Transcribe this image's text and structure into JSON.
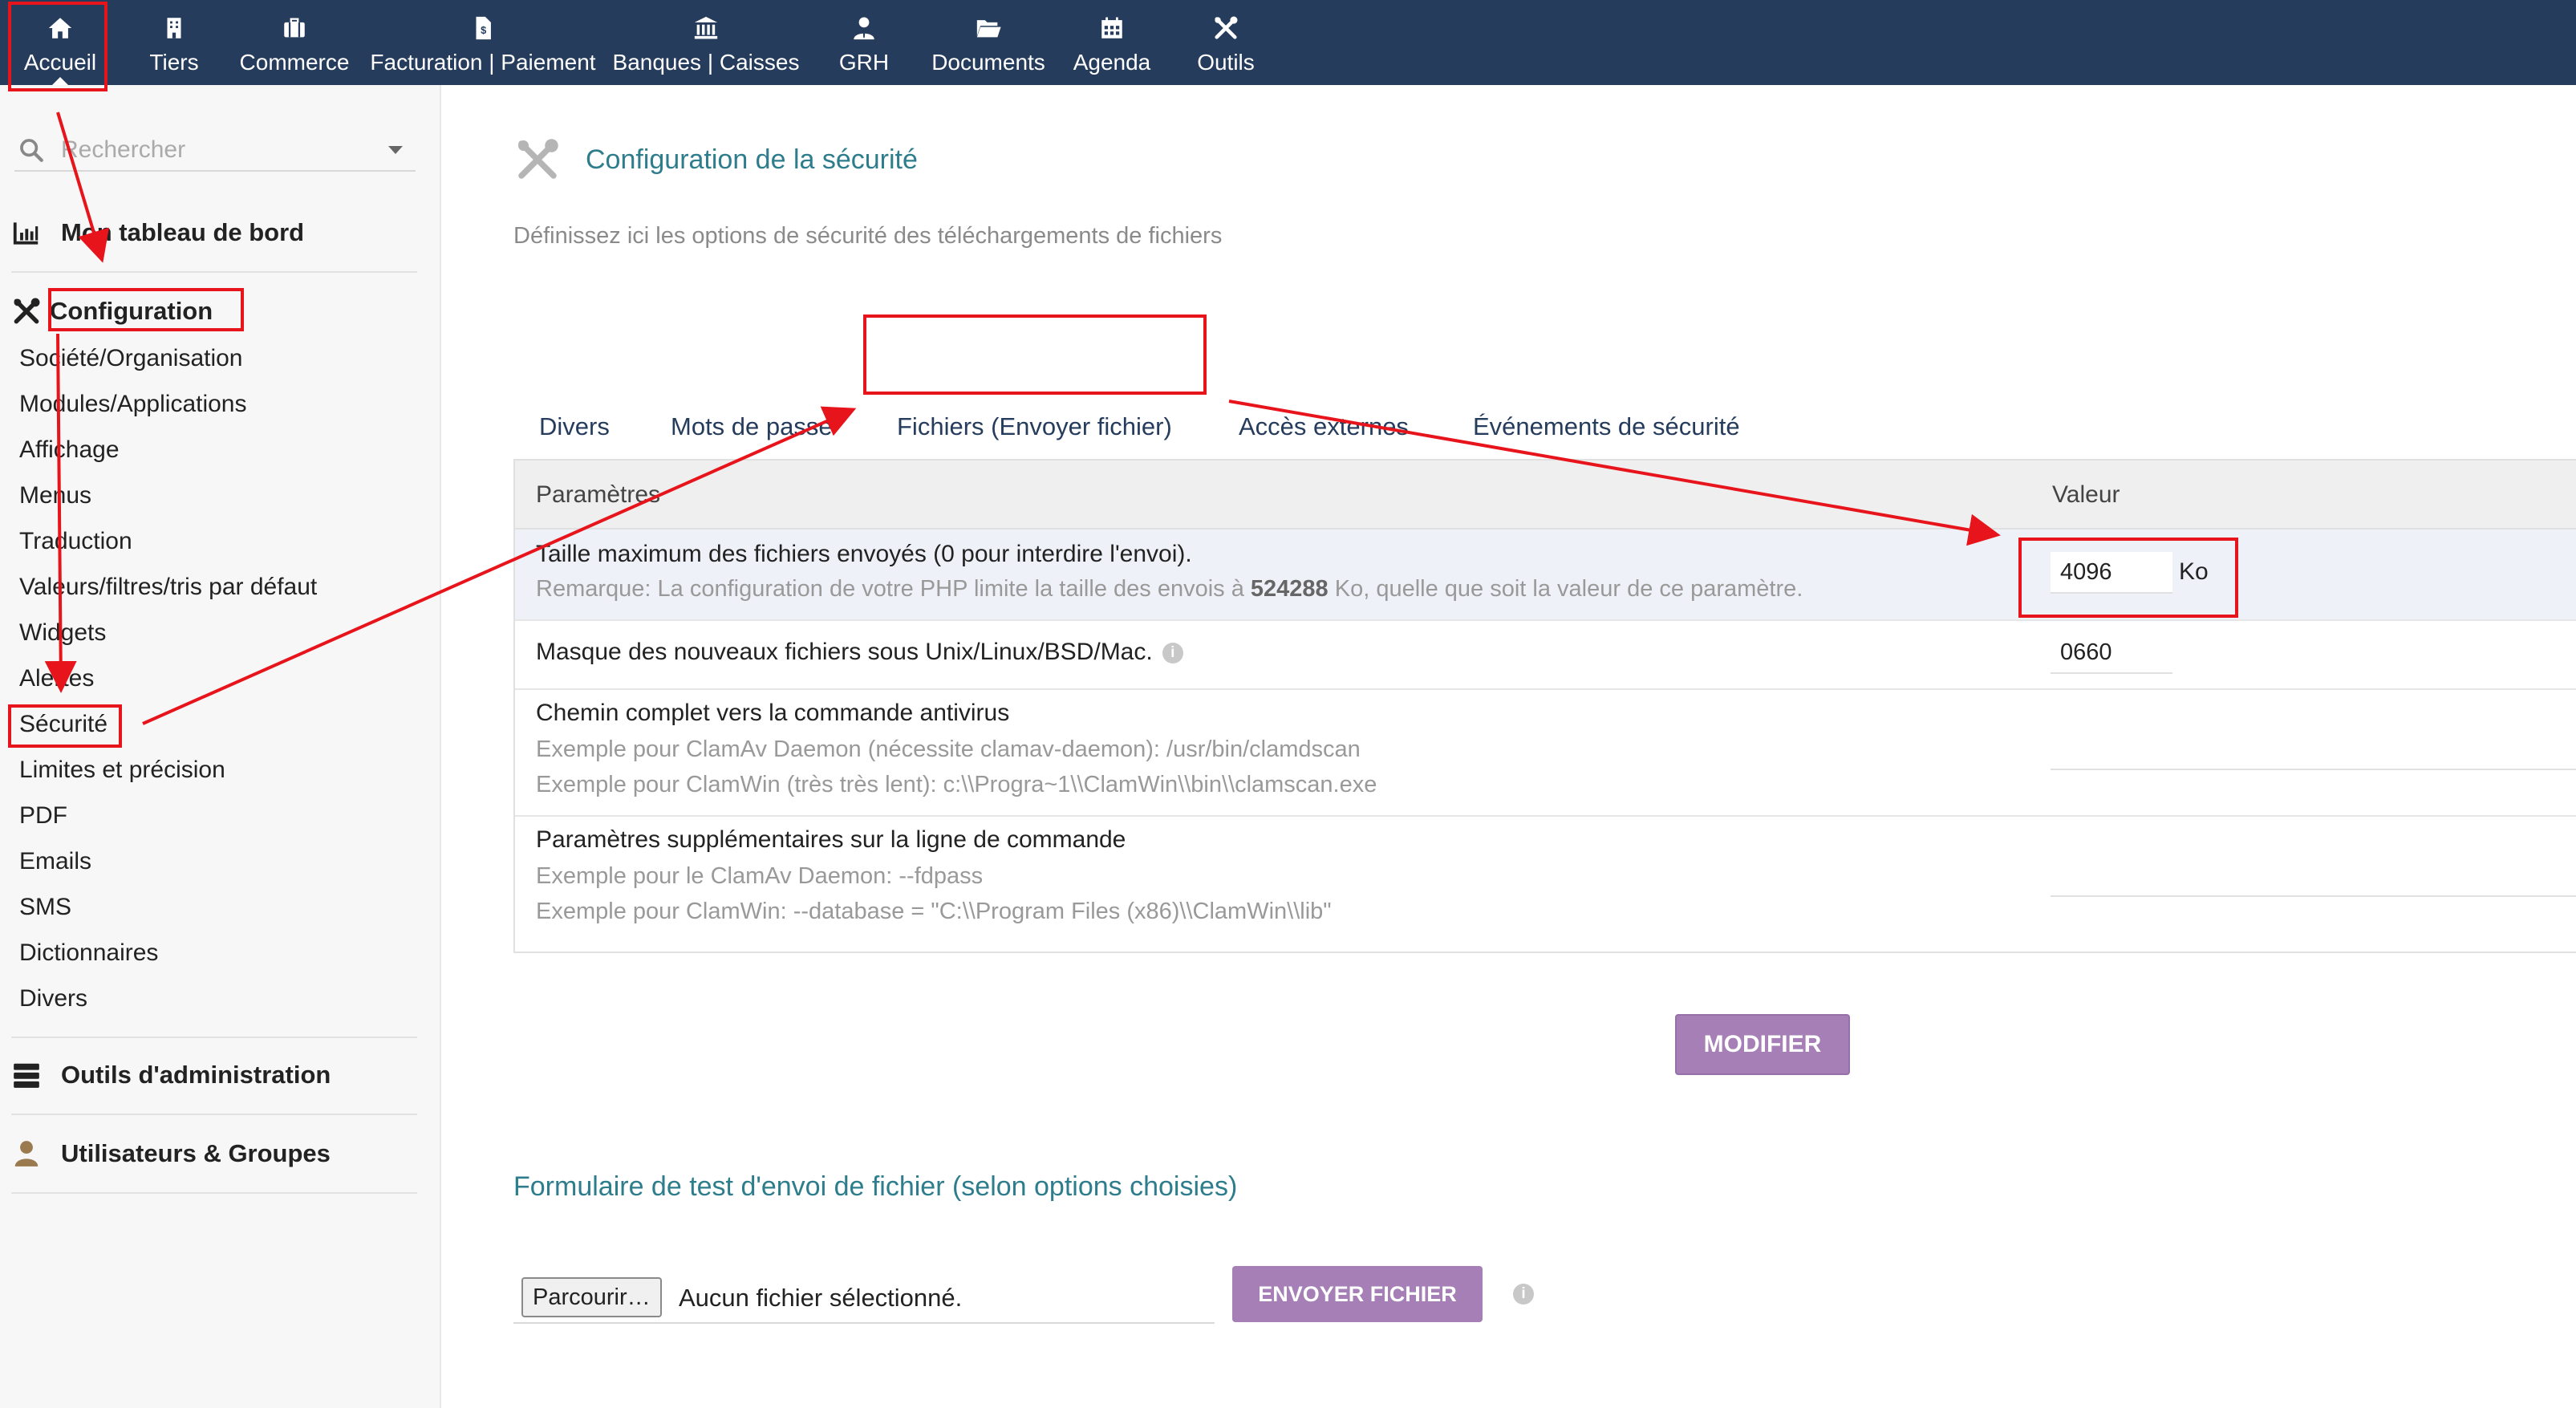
{
  "topnav": [
    {
      "label": "Accueil",
      "icon": "home-icon"
    },
    {
      "label": "Tiers",
      "icon": "building-icon"
    },
    {
      "label": "Commerce",
      "icon": "briefcase-icon"
    },
    {
      "label": "Facturation | Paiement",
      "icon": "invoice-icon"
    },
    {
      "label": "Banques | Caisses",
      "icon": "bank-icon"
    },
    {
      "label": "GRH",
      "icon": "user-tie-icon"
    },
    {
      "label": "Documents",
      "icon": "folder-icon"
    },
    {
      "label": "Agenda",
      "icon": "calendar-icon"
    },
    {
      "label": "Outils",
      "icon": "tools-icon"
    }
  ],
  "sidebar": {
    "search_placeholder": "Rechercher",
    "dashboard": "Mon tableau de bord",
    "configuration": "Configuration",
    "config_items": [
      "Société/Organisation",
      "Modules/Applications",
      "Affichage",
      "Menus",
      "Traduction",
      "Valeurs/filtres/tris par défaut",
      "Widgets",
      "Alertes",
      "Sécurité",
      "Limites et précision",
      "PDF",
      "Emails",
      "SMS",
      "Dictionnaires",
      "Divers"
    ],
    "admin_tools": "Outils d'administration",
    "users_groups": "Utilisateurs & Groupes"
  },
  "main": {
    "title": "Configuration de la sécurité",
    "description": "Définissez ici les options de sécurité des téléchargements de fichiers",
    "tabs": [
      "Divers",
      "Mots de passe",
      "Fichiers (Envoyer fichier)",
      "Accès externes",
      "Événements de sécurité"
    ],
    "table": {
      "col_param": "Paramètres",
      "col_value": "Valeur",
      "rows": [
        {
          "label": "Taille maximum des fichiers envoyés (0 pour interdire l'envoi).",
          "note_prefix": "Remarque: La configuration de votre PHP limite la taille des envois à ",
          "note_bold": "524288",
          "note_suffix": " Ko, quelle que soit la valeur de ce paramètre.",
          "value": "4096",
          "unit": "Ko"
        },
        {
          "label": "Masque des nouveaux fichiers sous Unix/Linux/BSD/Mac.",
          "value": "0660"
        },
        {
          "label": "Chemin complet vers la commande antivirus",
          "note1": "Exemple pour ClamAv Daemon (nécessite clamav-daemon): /usr/bin/clamdscan",
          "note2": "Exemple pour ClamWin (très très lent): c:\\\\Progra~1\\\\ClamWin\\\\bin\\\\clamscan.exe",
          "value": ""
        },
        {
          "label": "Paramètres supplémentaires sur la ligne de commande",
          "note1": "Exemple pour le ClamAv Daemon: --fdpass",
          "note2": "Exemple pour ClamWin: --database = \"C:\\\\Program Files (x86)\\\\ClamWin\\\\lib\"",
          "value": ""
        }
      ]
    },
    "modify_button": "MODIFIER",
    "test_title": "Formulaire de test d'envoi de fichier (selon options choisies)",
    "browse_button": "Parcourir…",
    "no_file": "Aucun fichier sélectionné.",
    "send_button": "ENVOYER FICHIER"
  },
  "colors": {
    "topbar": "#263c5c",
    "accent_title": "#2e7d8c",
    "button": "#a57fb5",
    "annotation": "#e8141b"
  }
}
